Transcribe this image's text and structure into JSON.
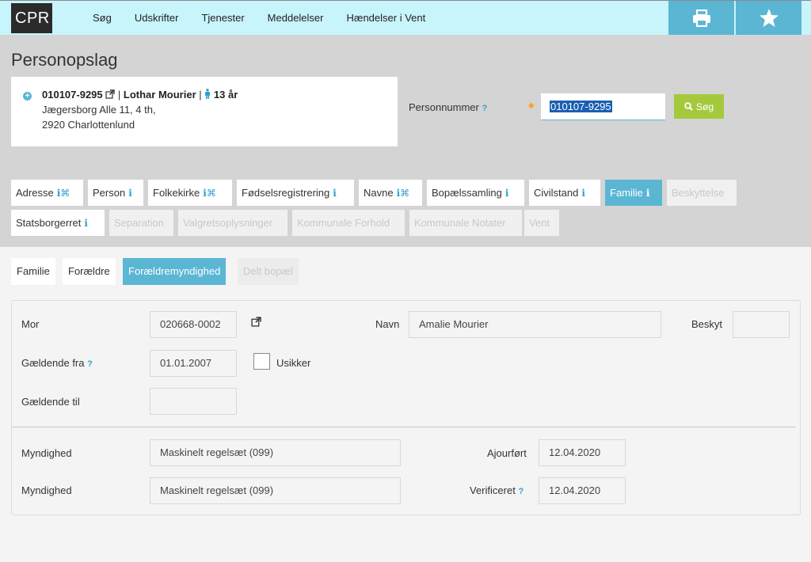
{
  "app": {
    "logo": "CPR"
  },
  "nav": {
    "items": [
      "Søg",
      "Udskrifter",
      "Tjenester",
      "Meddelelser",
      "Hændelser i Vent"
    ]
  },
  "page": {
    "title": "Personopslag"
  },
  "person": {
    "cpr": "010107-9295",
    "name": "Lothar Mourier",
    "age": "13 år",
    "address_line1": "Jægersborg Alle 11, 4 th,",
    "address_line2": "2920 Charlottenlund"
  },
  "search": {
    "label": "Personnummer",
    "help": "?",
    "required_marker": "◆",
    "value": "010107-9295",
    "button_label": "Søg"
  },
  "tabs": [
    {
      "label": "Adresse",
      "icon": "info",
      "icon2": "⌘",
      "state": "normal"
    },
    {
      "label": "Person",
      "icon": "info",
      "state": "normal"
    },
    {
      "label": "Folkekirke",
      "icon": "info",
      "icon2": "⌘",
      "state": "normal"
    },
    {
      "label": "Fødselsregistrering",
      "icon": "info",
      "state": "normal"
    },
    {
      "label": "Navne",
      "icon": "info",
      "icon2": "⌘",
      "state": "normal"
    },
    {
      "label": "Bopælssamling",
      "icon": "info",
      "state": "normal"
    },
    {
      "label": "Civilstand",
      "icon": "info",
      "state": "normal"
    },
    {
      "label": "Familie",
      "icon": "info",
      "state": "active"
    },
    {
      "label": "Beskyttelse",
      "state": "disabled"
    },
    {
      "label": "Statsborgerret",
      "icon": "info",
      "state": "normal"
    },
    {
      "label": "Separation",
      "state": "disabled"
    },
    {
      "label": "Valgretsoplysninger",
      "state": "disabled"
    },
    {
      "label": "Kommunale Forhold",
      "state": "disabled"
    },
    {
      "label": "Kommunale Notater",
      "state": "disabled"
    },
    {
      "label": "Vent",
      "state": "disabled"
    }
  ],
  "subtabs": [
    {
      "label": "Familie",
      "state": "normal"
    },
    {
      "label": "Forældre",
      "state": "normal"
    },
    {
      "label": "Forældremyndighed",
      "state": "active"
    },
    {
      "label": "Delt bopæl",
      "state": "disabled"
    }
  ],
  "form": {
    "mor_label": "Mor",
    "mor_value": "020668-0002",
    "navn_label": "Navn",
    "navn_value": "Amalie Mourier",
    "beskyt_label": "Beskyt",
    "beskyt_value": "",
    "gaeldende_fra_label": "Gældende fra",
    "gaeldende_fra_value": "01.01.2007",
    "usikker_label": "Usikker",
    "gaeldende_til_label": "Gældende til",
    "gaeldende_til_value": "",
    "myndighed1_label": "Myndighed",
    "myndighed1_value": "Maskinelt regelsæt (099)",
    "ajourfoert_label": "Ajourført",
    "ajourfoert_value": "12.04.2020",
    "myndighed2_label": "Myndighed",
    "myndighed2_value": "Maskinelt regelsæt (099)",
    "verificeret_label": "Verificeret",
    "verificeret_value": "12.04.2020",
    "help": "?"
  },
  "colors": {
    "accent": "#5bb6d4",
    "nav_bg": "#c8f4fb",
    "search_button": "#a5c93d",
    "header_bg": "#d4d4d4"
  }
}
